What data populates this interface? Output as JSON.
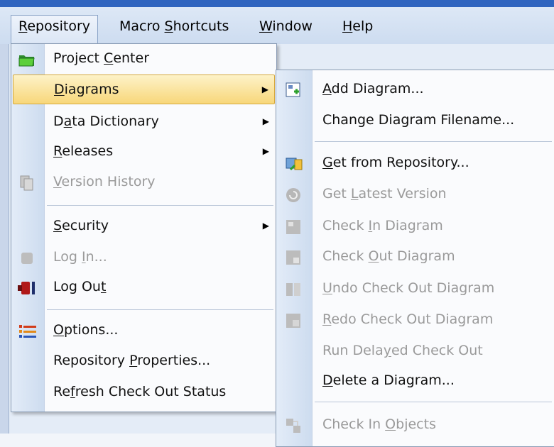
{
  "menubar": {
    "items": [
      {
        "label": "Repository",
        "u": "R"
      },
      {
        "label": "Macro Shortcuts",
        "u": "S"
      },
      {
        "label": "Window",
        "u": "W"
      },
      {
        "label": "Help",
        "u": "H"
      }
    ]
  },
  "repository_menu": {
    "items": [
      {
        "label": "Project Center",
        "icon": "folder-icon",
        "enabled": true
      },
      {
        "label": "Diagrams",
        "submenu": true,
        "enabled": true,
        "highlighted": true
      },
      {
        "label": "Data Dictionary",
        "submenu": true,
        "enabled": true
      },
      {
        "label": "Releases",
        "submenu": true,
        "enabled": true
      },
      {
        "label": "Version History",
        "icon": "version-history-icon",
        "enabled": false
      },
      {
        "label": "Security",
        "submenu": true,
        "enabled": true
      },
      {
        "label": "Log In...",
        "icon": "log-in-icon",
        "enabled": false
      },
      {
        "label": "Log Out",
        "icon": "log-out-icon",
        "enabled": true
      },
      {
        "label": "Options...",
        "icon": "options-list-icon",
        "enabled": true
      },
      {
        "label": "Repository Properties...",
        "enabled": true
      },
      {
        "label": "Refresh Check Out Status",
        "enabled": true
      }
    ]
  },
  "diagrams_submenu": {
    "items": [
      {
        "label": "Add Diagram...",
        "icon": "add-diagram-icon",
        "enabled": true
      },
      {
        "label": "Change Diagram Filename...",
        "enabled": true
      },
      {
        "label": "Get from Repository...",
        "icon": "get-from-repository-icon",
        "enabled": true
      },
      {
        "label": "Get Latest Version",
        "icon": "get-latest-version-icon",
        "enabled": false
      },
      {
        "label": "Check In Diagram",
        "icon": "check-in-diagram-icon",
        "enabled": false
      },
      {
        "label": "Check Out Diagram",
        "icon": "check-out-diagram-icon",
        "enabled": false
      },
      {
        "label": "Undo Check Out Diagram",
        "icon": "undo-check-out-icon",
        "enabled": false
      },
      {
        "label": "Redo Check Out Diagram",
        "icon": "redo-check-out-icon",
        "enabled": false
      },
      {
        "label": "Run Delayed Check Out",
        "enabled": false
      },
      {
        "label": "Delete a Diagram...",
        "enabled": true
      },
      {
        "label": "Check In Objects",
        "icon": "check-in-objects-icon",
        "enabled": false
      }
    ]
  },
  "colors": {
    "highlight": "#f8d77a",
    "disabled_text": "#9a9a9a",
    "title_strip": "#2f64bf"
  }
}
